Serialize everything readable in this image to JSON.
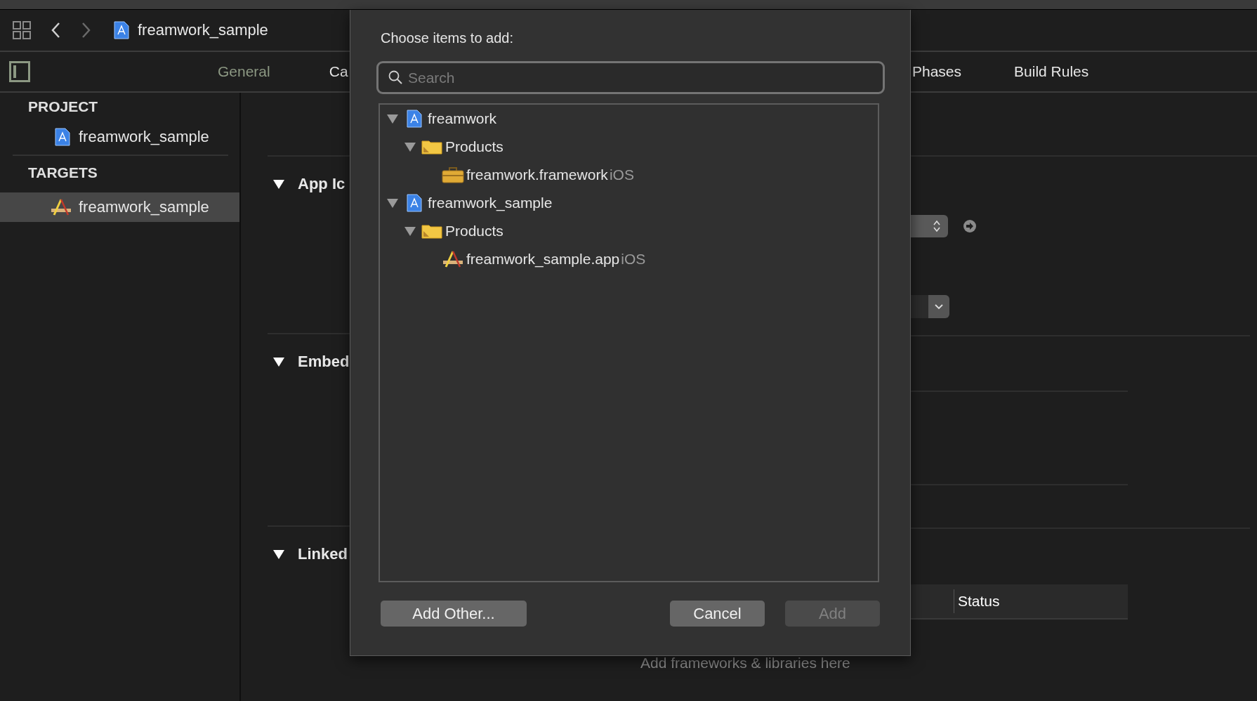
{
  "toolbar": {
    "title": "freamwork_sample"
  },
  "tabs": [
    {
      "label": "General",
      "selected": true
    },
    {
      "label": "Ca",
      "selected": false
    },
    {
      "label": "Phases",
      "selected": false
    },
    {
      "label": "Build Rules",
      "selected": false
    }
  ],
  "sidebar": {
    "sections": [
      {
        "header": "PROJECT",
        "items": [
          {
            "label": "freamwork_sample",
            "kind": "project",
            "selected": false
          }
        ]
      },
      {
        "header": "TARGETS",
        "items": [
          {
            "label": "freamwork_sample",
            "kind": "app",
            "selected": true
          }
        ]
      }
    ]
  },
  "content": {
    "sections": [
      {
        "title": "App Ic",
        "expanded": true
      },
      {
        "title": "Embed",
        "expanded": true
      },
      {
        "title": "Linked",
        "expanded": true
      }
    ],
    "table": {
      "columns": [
        "Status"
      ]
    },
    "hint": "Add frameworks & libraries here"
  },
  "sheet": {
    "title": "Choose items to add:",
    "search": {
      "placeholder": "Search"
    },
    "tree": [
      {
        "label": "freamwork",
        "kind": "project",
        "expanded": true,
        "children": [
          {
            "label": "Products",
            "kind": "folder",
            "expanded": true,
            "children": [
              {
                "label": "freamwork.framework",
                "kind": "framework",
                "platform": "iOS"
              }
            ]
          }
        ]
      },
      {
        "label": "freamwork_sample",
        "kind": "project",
        "expanded": true,
        "children": [
          {
            "label": "Products",
            "kind": "folder",
            "expanded": true,
            "children": [
              {
                "label": "freamwork_sample.app",
                "kind": "app",
                "platform": "iOS"
              }
            ]
          }
        ]
      }
    ],
    "buttons": [
      {
        "label": "Add Other...",
        "disabled": false
      },
      {
        "label": "Cancel",
        "disabled": false
      },
      {
        "label": "Add",
        "disabled": true
      }
    ]
  }
}
